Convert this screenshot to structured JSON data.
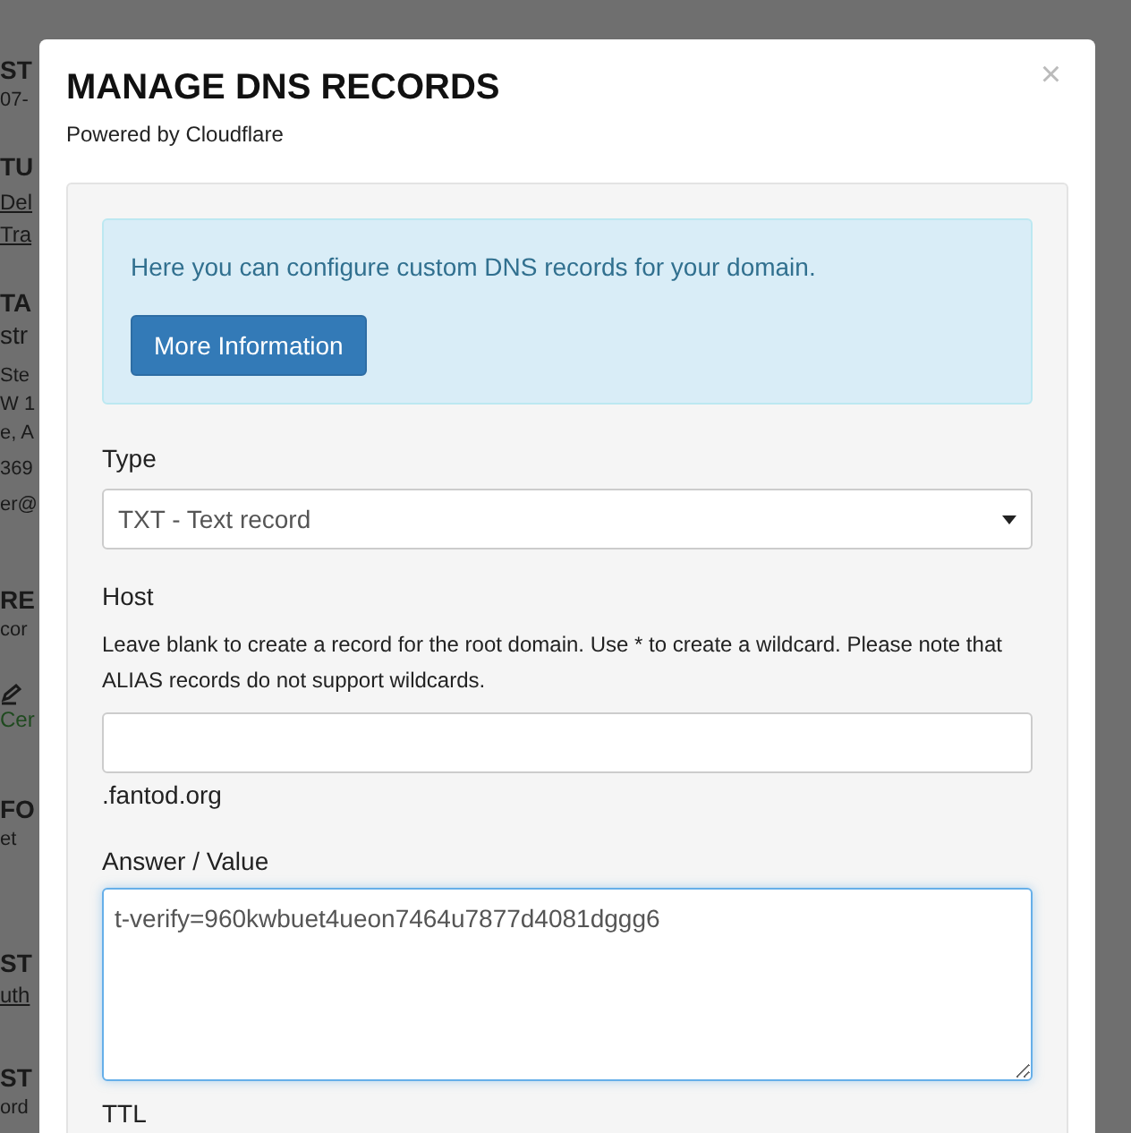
{
  "background_page": [
    {
      "kind": "heading",
      "text": "ST"
    },
    {
      "kind": "text",
      "text": "07-"
    },
    {
      "kind": "heading",
      "text": "TU"
    },
    {
      "kind": "link",
      "text": "Del"
    },
    {
      "kind": "link",
      "text": "Tra"
    },
    {
      "kind": "heading",
      "text": "TA"
    },
    {
      "kind": "large",
      "text": "str"
    },
    {
      "kind": "text",
      "text": "Ste"
    },
    {
      "kind": "text",
      "text": "W 1"
    },
    {
      "kind": "text",
      "text": "e, A"
    },
    {
      "kind": "text",
      "text": "369"
    },
    {
      "kind": "text",
      "text": "er@"
    },
    {
      "kind": "heading",
      "text": "RE"
    },
    {
      "kind": "text",
      "text": "cor"
    },
    {
      "kind": "icon"
    },
    {
      "kind": "green",
      "text": "Cer"
    },
    {
      "kind": "heading",
      "text": "FO"
    },
    {
      "kind": "text",
      "text": "et"
    },
    {
      "kind": "heading",
      "text": "ST"
    },
    {
      "kind": "link",
      "text": "uth"
    },
    {
      "kind": "heading",
      "text": "ST"
    },
    {
      "kind": "text",
      "text": "ord"
    }
  ],
  "modal": {
    "title": "MANAGE DNS RECORDS",
    "subtitle": "Powered by Cloudflare",
    "close": "×",
    "info": {
      "text": "Here you can configure custom DNS records for your domain.",
      "button": "More Information"
    },
    "type": {
      "label": "Type",
      "value": "TXT - Text record"
    },
    "host": {
      "label": "Host",
      "help": "Leave blank to create a record for the root domain. Use * to create a wildcard. Please note that ALIAS records do not support wildcards.",
      "suffix": ".fantod.org"
    },
    "answer": {
      "label": "Answer / Value",
      "value": "t-verify=960kwbuet4ueon7464u7877d4081dggg6"
    },
    "ttl": {
      "label": "TTL"
    }
  }
}
